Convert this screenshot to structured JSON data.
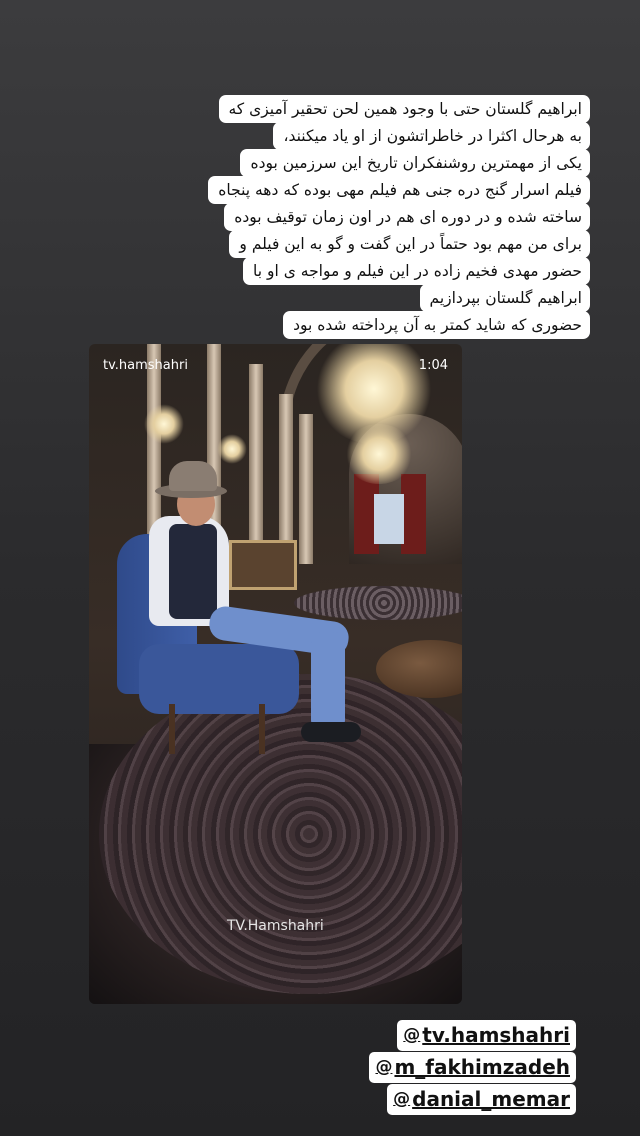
{
  "caption": {
    "lines": [
      "ابراهیم گلستان حتی با وجود همین لحن تحقیر آمیزی که",
      "به هرحال اکثرا در خاطراتشون از او یاد میکنند،",
      "یکی از مهمترین روشنفکران تاریخ این سرزمین بوده",
      "فیلم اسرار گنج دره جنی هم فیلم مهی بوده که دهه پنجاه",
      "ساخته شده و در دوره‌ ای هم در اون زمان توقیف بوده",
      "برای من مهم بود حتماً در این گفت و گو به این فیلم و",
      "حضور مهدی فخیم زاده در این فیلم و مواجه ی او با",
      "ابراهیم گلستان بپردازیم",
      "حضوری که شاید کمتر به آن پرداخته شده بود"
    ]
  },
  "video": {
    "handle": "tv.hamshahri",
    "time": "1:04",
    "watermark": "TV.Hamshahri"
  },
  "mentions": [
    {
      "icon": "@",
      "text": "tv.hamshahri"
    },
    {
      "icon": "@",
      "text": "m_fakhimzadeh"
    },
    {
      "icon": "@",
      "text": "danial_memar"
    }
  ],
  "colors": {
    "background": "#2e2e30",
    "caption_bg": "#ffffff",
    "chair": "#3a579a"
  }
}
